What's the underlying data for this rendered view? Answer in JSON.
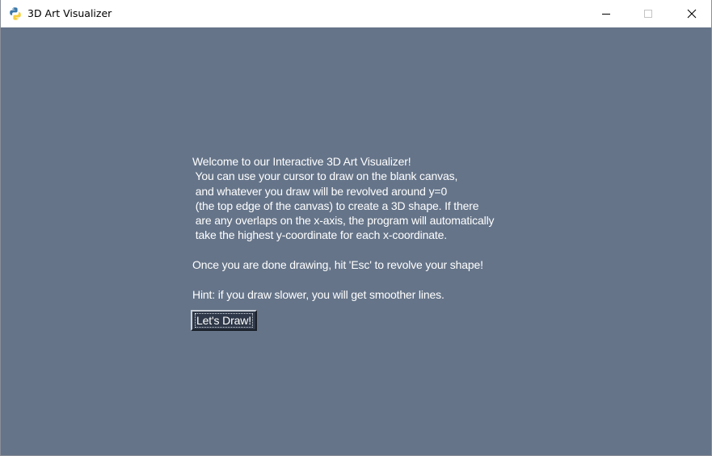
{
  "window": {
    "title": "3D Art Visualizer",
    "app_icon": "python-icon",
    "controls": {
      "minimize_icon": "minimize-icon",
      "maximize_icon": "maximize-icon",
      "close_icon": "close-icon"
    }
  },
  "main": {
    "background_color": "#657489",
    "welcome_text": "Welcome to our Interactive 3D Art Visualizer!\n You can use your cursor to draw on the blank canvas,\n and whatever you draw will be revolved around y=0\n (the top edge of the canvas) to create a 3D shape. If there\n are any overlaps on the x-axis, the program will automatically\n take the highest y-coordinate for each x-coordinate.\n\nOnce you are done drawing, hit 'Esc' to revolve your shape!\n\nHint: if you draw slower, you will get smoother lines.",
    "draw_button_label": "Let's Draw!"
  }
}
